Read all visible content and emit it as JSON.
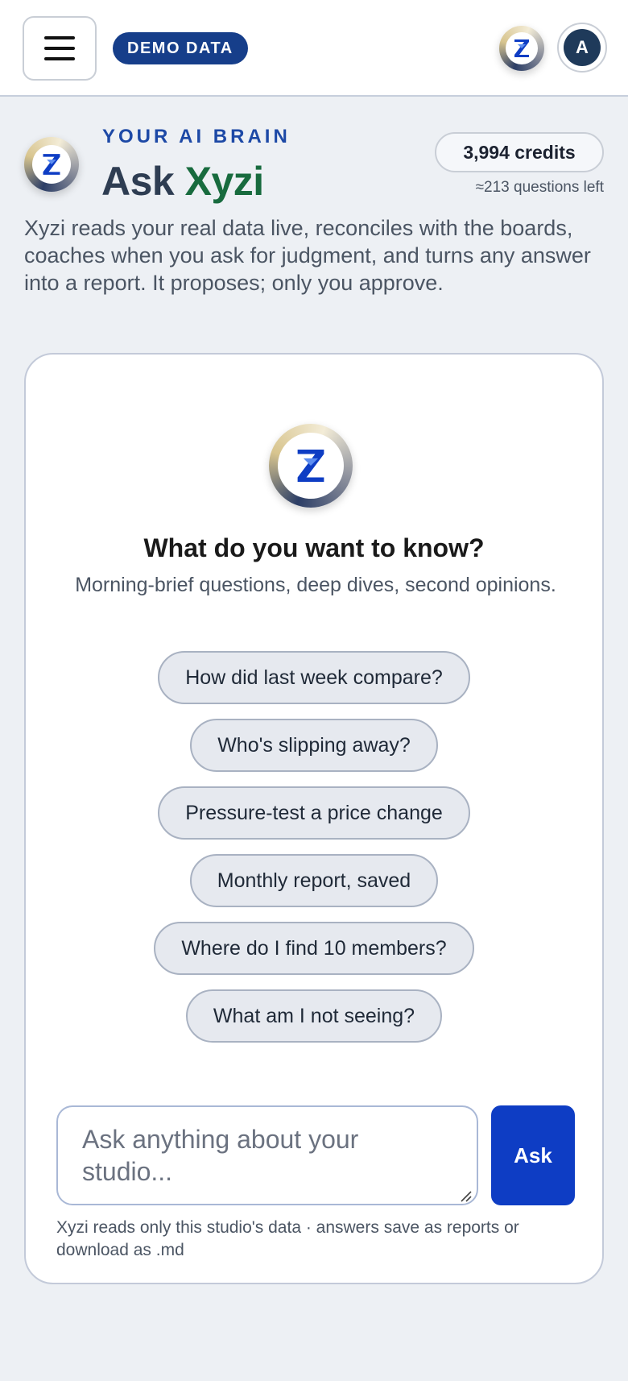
{
  "topbar": {
    "menu_icon": "hamburger-menu-icon",
    "demo_badge": "DEMO DATA",
    "logo_icon": "hourglass-logo-icon",
    "avatar_initial": "A"
  },
  "header": {
    "eyebrow": "YOUR AI BRAIN",
    "title_prefix": "Ask ",
    "title_accent": "Xyzi",
    "credits": "3,994 credits",
    "questions_left": "≈213 questions left",
    "intro": "Xyzi reads your real data live, reconciles with the boards, coaches when you ask for judgment, and turns any answer into a report. It proposes; only you approve."
  },
  "card": {
    "title": "What do you want to know?",
    "subtitle": "Morning-brief questions, deep dives, second opinions.",
    "suggestions": [
      "How did last week compare?",
      "Who's slipping away?",
      "Pressure-test a price change",
      "Monthly report, saved",
      "Where do I find 10 members?",
      "What am I not seeing?"
    ],
    "input_placeholder": "Ask anything about your studio...",
    "input_value": "",
    "ask_label": "Ask",
    "footnote": "Xyzi reads only this studio's data · answers save as reports or download as .md"
  },
  "colors": {
    "brand_blue": "#0e3dc4",
    "badge_navy": "#163e8a",
    "accent_green": "#186b3e",
    "eyebrow_blue": "#1d49a6"
  }
}
